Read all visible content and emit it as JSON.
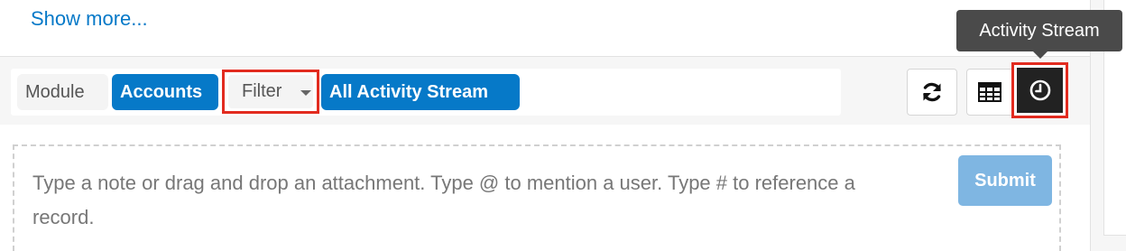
{
  "dashlet": {
    "show_more_label": "Show more..."
  },
  "filter_bar": {
    "module_label": "Module",
    "module_value": "Accounts",
    "filter_label": "Filter",
    "filter_value": "All Activity Stream"
  },
  "view_toggles": {
    "refresh_icon": "refresh-icon",
    "list_view_icon": "table-icon",
    "activity_stream_icon": "clock-icon",
    "tooltip": "Activity Stream"
  },
  "composer": {
    "placeholder": "Type a note or drag and drop an attachment. Type @ to mention a user. Type # to reference a record.",
    "submit_label": "Submit"
  },
  "colors": {
    "accent": "#0679c8",
    "highlight_outline": "#e22b1f",
    "submit_disabled": "#7fb6e2",
    "active_toggle": "#222222"
  }
}
